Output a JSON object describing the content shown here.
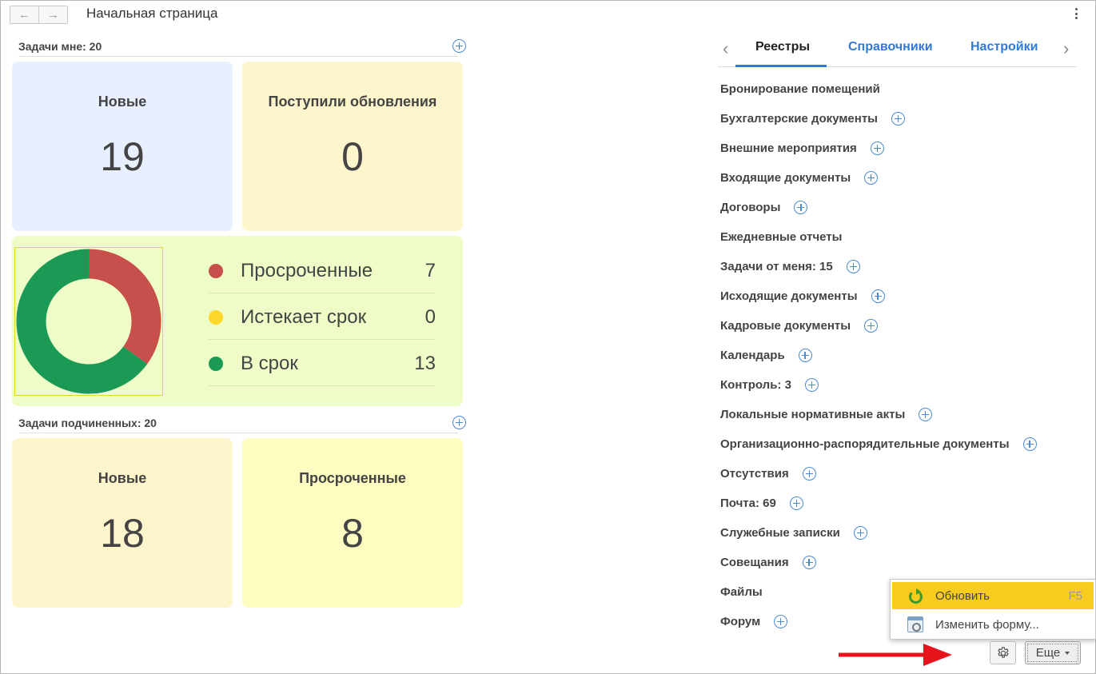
{
  "header": {
    "back_icon": "arrow-left-icon",
    "forward_icon": "arrow-right-icon",
    "title": "Начальная страница",
    "menu_icon": "kebab-icon"
  },
  "my_tasks": {
    "heading": "Задачи мне: 20",
    "tiles": [
      {
        "label": "Новые",
        "value": "19",
        "color": "#e8efff"
      },
      {
        "label": "Поступили обновления",
        "value": "0",
        "color": "#fff5cc"
      }
    ],
    "status": {
      "colors": {
        "panel": "#eefcc8"
      },
      "items": [
        {
          "label": "Просроченные",
          "value": 7,
          "color": "#c8504c"
        },
        {
          "label": "Истекает срок",
          "value": 0,
          "color": "#ffd72a"
        },
        {
          "label": "В срок",
          "value": 13,
          "color": "#1a9a55"
        }
      ]
    }
  },
  "subordinates": {
    "heading": "Задачи подчиненных: 20",
    "tiles": [
      {
        "label": "Новые",
        "value": "18",
        "color": "#fff5cc"
      },
      {
        "label": "Просроченные",
        "value": "8",
        "color": "#fdfdc2"
      }
    ]
  },
  "tabs": {
    "items": [
      "Реестры",
      "Справочники",
      "Настройки"
    ],
    "active": "Реестры",
    "accent": "#2f7ad6"
  },
  "registers": [
    {
      "label": "Бронирование помещений",
      "plus": false
    },
    {
      "label": "Бухгалтерские документы",
      "plus": true
    },
    {
      "label": "Внешние мероприятия",
      "plus": true
    },
    {
      "label": "Входящие документы",
      "plus": true
    },
    {
      "label": "Договоры",
      "plus": true
    },
    {
      "label": "Ежедневные отчеты",
      "plus": false
    },
    {
      "label": "Задачи от меня: 15",
      "plus": true
    },
    {
      "label": "Исходящие документы",
      "plus": true
    },
    {
      "label": "Кадровые документы",
      "plus": true
    },
    {
      "label": "Календарь",
      "plus": true
    },
    {
      "label": "Контроль: 3",
      "plus": true
    },
    {
      "label": "Локальные нормативные акты",
      "plus": true
    },
    {
      "label": "Организационно-распорядительные документы",
      "plus": true
    },
    {
      "label": "Отсутствия",
      "plus": true
    },
    {
      "label": "Почта: 69",
      "plus": true
    },
    {
      "label": "Служебные записки",
      "plus": true
    },
    {
      "label": "Совещания",
      "plus": true
    },
    {
      "label": "Файлы",
      "plus": false
    },
    {
      "label": "Форум",
      "plus": true
    }
  ],
  "context_menu": {
    "refresh_label": "Обновить",
    "refresh_shortcut": "F5",
    "edit_form_label": "Изменить форму...",
    "highlight": "#f7cc1f"
  },
  "footer": {
    "more_label": "Еще",
    "gear_icon": "gear-icon",
    "arrow_color": "#e8141c"
  }
}
